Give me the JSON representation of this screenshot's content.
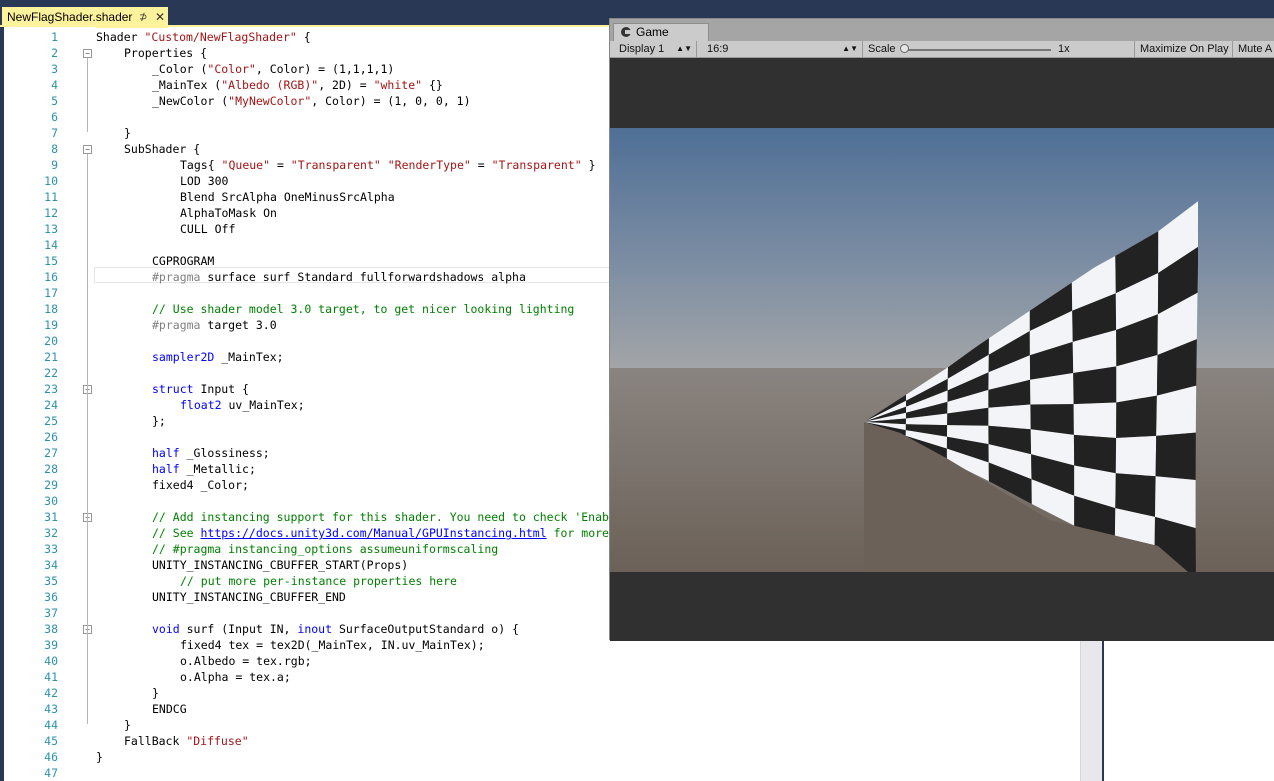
{
  "editor": {
    "tab_title": "NewFlagShader.shader",
    "tab_pin": "⊅",
    "tab_close": "✕"
  },
  "code_lines": [
    {
      "n": "1",
      "fold": "",
      "indent": 0,
      "parts": [
        [
          "t",
          "Shader "
        ],
        [
          "str",
          "\"Custom/NewFlagShader\""
        ],
        [
          "t",
          " {"
        ]
      ]
    },
    {
      "n": "2",
      "fold": "-",
      "indent": 1,
      "parts": [
        [
          "t",
          "Properties {"
        ]
      ]
    },
    {
      "n": "3",
      "fold": "",
      "indent": 2,
      "parts": [
        [
          "t",
          "_Color ("
        ],
        [
          "str",
          "\"Color\""
        ],
        [
          "t",
          ", Color) = (1,1,1,1)"
        ]
      ]
    },
    {
      "n": "4",
      "fold": "",
      "indent": 2,
      "parts": [
        [
          "t",
          "_MainTex ("
        ],
        [
          "str",
          "\"Albedo (RGB)\""
        ],
        [
          "t",
          ", 2D) = "
        ],
        [
          "str",
          "\"white\""
        ],
        [
          "t",
          " {}"
        ]
      ]
    },
    {
      "n": "5",
      "fold": "",
      "indent": 2,
      "parts": [
        [
          "t",
          "_NewColor ("
        ],
        [
          "str",
          "\"MyNewColor\""
        ],
        [
          "t",
          ", Color) = (1, 0, 0, 1)"
        ]
      ]
    },
    {
      "n": "6",
      "fold": "",
      "indent": 0,
      "parts": []
    },
    {
      "n": "7",
      "fold": "",
      "indent": 1,
      "parts": [
        [
          "t",
          "}"
        ]
      ]
    },
    {
      "n": "8",
      "fold": "-",
      "indent": 1,
      "parts": [
        [
          "t",
          "SubShader {"
        ]
      ]
    },
    {
      "n": "9",
      "fold": "",
      "indent": 3,
      "parts": [
        [
          "t",
          "Tags{ "
        ],
        [
          "str",
          "\"Queue\""
        ],
        [
          "t",
          " = "
        ],
        [
          "str",
          "\"Transparent\""
        ],
        [
          "t",
          " "
        ],
        [
          "str",
          "\"RenderType\""
        ],
        [
          "t",
          " = "
        ],
        [
          "str",
          "\"Transparent\""
        ],
        [
          "t",
          " }"
        ]
      ]
    },
    {
      "n": "10",
      "fold": "",
      "indent": 3,
      "parts": [
        [
          "t",
          "LOD 300"
        ]
      ]
    },
    {
      "n": "11",
      "fold": "",
      "indent": 3,
      "parts": [
        [
          "t",
          "Blend SrcAlpha OneMinusSrcAlpha"
        ]
      ]
    },
    {
      "n": "12",
      "fold": "",
      "indent": 3,
      "parts": [
        [
          "t",
          "AlphaToMask On"
        ]
      ]
    },
    {
      "n": "13",
      "fold": "",
      "indent": 3,
      "parts": [
        [
          "t",
          "CULL Off"
        ]
      ]
    },
    {
      "n": "14",
      "fold": "",
      "indent": 0,
      "parts": []
    },
    {
      "n": "15",
      "fold": "",
      "indent": 2,
      "parts": [
        [
          "t",
          "CGPROGRAM"
        ]
      ]
    },
    {
      "n": "16",
      "fold": "",
      "indent": 2,
      "parts": [
        [
          "pp",
          "#pragma"
        ],
        [
          "t",
          " surface surf Standard fullforwardshadows alpha"
        ]
      ]
    },
    {
      "n": "17",
      "fold": "",
      "indent": 0,
      "parts": []
    },
    {
      "n": "18",
      "fold": "",
      "indent": 2,
      "parts": [
        [
          "cm",
          "// Use shader model 3.0 target, to get nicer looking lighting"
        ]
      ]
    },
    {
      "n": "19",
      "fold": "",
      "indent": 2,
      "parts": [
        [
          "pp",
          "#pragma"
        ],
        [
          "t",
          " target 3.0"
        ]
      ]
    },
    {
      "n": "20",
      "fold": "",
      "indent": 0,
      "parts": []
    },
    {
      "n": "21",
      "fold": "",
      "indent": 2,
      "parts": [
        [
          "kw",
          "sampler2D"
        ],
        [
          "t",
          " _MainTex;"
        ]
      ]
    },
    {
      "n": "22",
      "fold": "",
      "indent": 0,
      "parts": []
    },
    {
      "n": "23",
      "fold": "-",
      "indent": 2,
      "parts": [
        [
          "kw",
          "struct"
        ],
        [
          "t",
          " Input {"
        ]
      ]
    },
    {
      "n": "24",
      "fold": "",
      "indent": 3,
      "parts": [
        [
          "kw",
          "float2"
        ],
        [
          "t",
          " uv_MainTex;"
        ]
      ]
    },
    {
      "n": "25",
      "fold": "",
      "indent": 2,
      "parts": [
        [
          "t",
          "};"
        ]
      ]
    },
    {
      "n": "26",
      "fold": "",
      "indent": 0,
      "parts": []
    },
    {
      "n": "27",
      "fold": "",
      "indent": 2,
      "parts": [
        [
          "kw",
          "half"
        ],
        [
          "t",
          " _Glossiness;"
        ]
      ]
    },
    {
      "n": "28",
      "fold": "",
      "indent": 2,
      "parts": [
        [
          "kw",
          "half"
        ],
        [
          "t",
          " _Metallic;"
        ]
      ]
    },
    {
      "n": "29",
      "fold": "",
      "indent": 2,
      "parts": [
        [
          "t",
          "fixed4 _Color;"
        ]
      ]
    },
    {
      "n": "30",
      "fold": "",
      "indent": 0,
      "parts": []
    },
    {
      "n": "31",
      "fold": "-",
      "indent": 2,
      "parts": [
        [
          "cm",
          "// Add instancing support for this shader. You need to check 'Enab"
        ]
      ]
    },
    {
      "n": "32",
      "fold": "",
      "indent": 2,
      "parts": [
        [
          "cm",
          "// See "
        ],
        [
          "lnk",
          "https://docs.unity3d.com/Manual/GPUInstancing.html"
        ],
        [
          "cm",
          " for more"
        ]
      ]
    },
    {
      "n": "33",
      "fold": "",
      "indent": 2,
      "parts": [
        [
          "cm",
          "// #pragma instancing_options assumeuniformscaling"
        ]
      ]
    },
    {
      "n": "34",
      "fold": "",
      "indent": 2,
      "parts": [
        [
          "t",
          "UNITY_INSTANCING_CBUFFER_START(Props)"
        ]
      ]
    },
    {
      "n": "35",
      "fold": "",
      "indent": 3,
      "parts": [
        [
          "cm",
          "// put more per-instance properties here"
        ]
      ]
    },
    {
      "n": "36",
      "fold": "",
      "indent": 2,
      "parts": [
        [
          "t",
          "UNITY_INSTANCING_CBUFFER_END"
        ]
      ]
    },
    {
      "n": "37",
      "fold": "",
      "indent": 0,
      "parts": []
    },
    {
      "n": "38",
      "fold": "-",
      "indent": 2,
      "parts": [
        [
          "kw",
          "void"
        ],
        [
          "t",
          " surf (Input IN, "
        ],
        [
          "kw",
          "inout"
        ],
        [
          "t",
          " SurfaceOutputStandard o) {"
        ]
      ]
    },
    {
      "n": "39",
      "fold": "",
      "indent": 3,
      "parts": [
        [
          "t",
          "fixed4 tex = tex2D(_MainTex, IN.uv_MainTex);"
        ]
      ]
    },
    {
      "n": "40",
      "fold": "",
      "indent": 3,
      "parts": [
        [
          "t",
          "o.Albedo = tex.rgb;"
        ]
      ]
    },
    {
      "n": "41",
      "fold": "",
      "indent": 3,
      "parts": [
        [
          "t",
          "o.Alpha = tex.a;"
        ]
      ]
    },
    {
      "n": "42",
      "fold": "",
      "indent": 2,
      "parts": [
        [
          "t",
          "}"
        ]
      ]
    },
    {
      "n": "43",
      "fold": "",
      "indent": 2,
      "parts": [
        [
          "t",
          "ENDCG"
        ]
      ]
    },
    {
      "n": "44",
      "fold": "",
      "indent": 1,
      "parts": [
        [
          "t",
          "}"
        ]
      ]
    },
    {
      "n": "45",
      "fold": "",
      "indent": 1,
      "parts": [
        [
          "t",
          "FallBack "
        ],
        [
          "str",
          "\"Diffuse\""
        ]
      ]
    },
    {
      "n": "46",
      "fold": "",
      "indent": 0,
      "parts": [
        [
          "t",
          "}"
        ]
      ]
    },
    {
      "n": "47",
      "fold": "",
      "indent": 0,
      "parts": []
    }
  ],
  "game": {
    "tab_label": "Game",
    "display_label": "Display 1",
    "aspect_label": "16:9",
    "scale_label": "Scale",
    "scale_value": "1x",
    "maximize_label": "Maximize On Play",
    "mute_label": "Mute A"
  },
  "colors": {
    "vs_chrome": "#293955",
    "tab_active": "#fff29d",
    "line_number": "#2b91af",
    "string": "#a31515",
    "keyword": "#0000ff",
    "comment": "#008000",
    "sky_top": "#4f6f96",
    "ground": "#6b6158"
  }
}
